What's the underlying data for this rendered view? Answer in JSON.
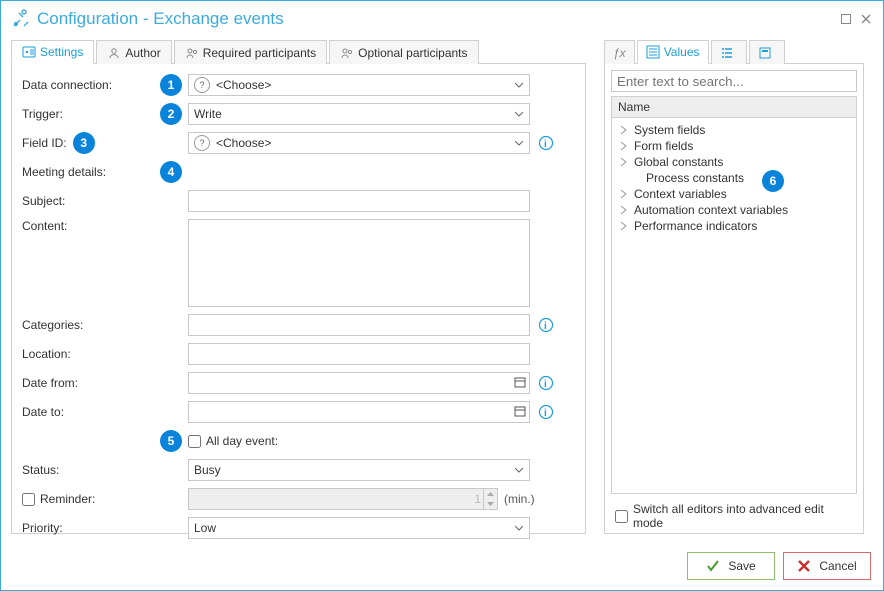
{
  "title": "Configuration - Exchange events",
  "leftTabs": [
    "Settings",
    "Author",
    "Required participants",
    "Optional participants"
  ],
  "callouts": [
    "1",
    "2",
    "3",
    "4",
    "5",
    "6"
  ],
  "form": {
    "dataConnection": {
      "label": "Data connection:",
      "value": "<Choose>"
    },
    "trigger": {
      "label": "Trigger:",
      "value": "Write"
    },
    "fieldId": {
      "label": "Field ID:",
      "value": "<Choose>"
    },
    "meetingDetailsLabel": "Meeting details:",
    "subject": {
      "label": "Subject:"
    },
    "content": {
      "label": "Content:"
    },
    "categories": {
      "label": "Categories:"
    },
    "location": {
      "label": "Location:"
    },
    "dateFrom": {
      "label": "Date from:"
    },
    "dateTo": {
      "label": "Date to:"
    },
    "allDayEvent": {
      "label": "All day event:"
    },
    "status": {
      "label": "Status:",
      "value": "Busy"
    },
    "reminder": {
      "label": "Reminder:",
      "value": "1",
      "unit": "(min.)"
    },
    "priority": {
      "label": "Priority:",
      "value": "Low"
    }
  },
  "rightTabs": {
    "values": "Values"
  },
  "right": {
    "searchPlaceholder": "Enter text to search...",
    "gridHeader": "Name",
    "tree": [
      "System fields",
      "Form fields",
      "Global constants",
      "Process constants",
      "Context variables",
      "Automation context variables",
      "Performance indicators"
    ],
    "advancedLabel": "Switch all editors into advanced edit mode"
  },
  "footer": {
    "save": "Save",
    "cancel": "Cancel"
  }
}
